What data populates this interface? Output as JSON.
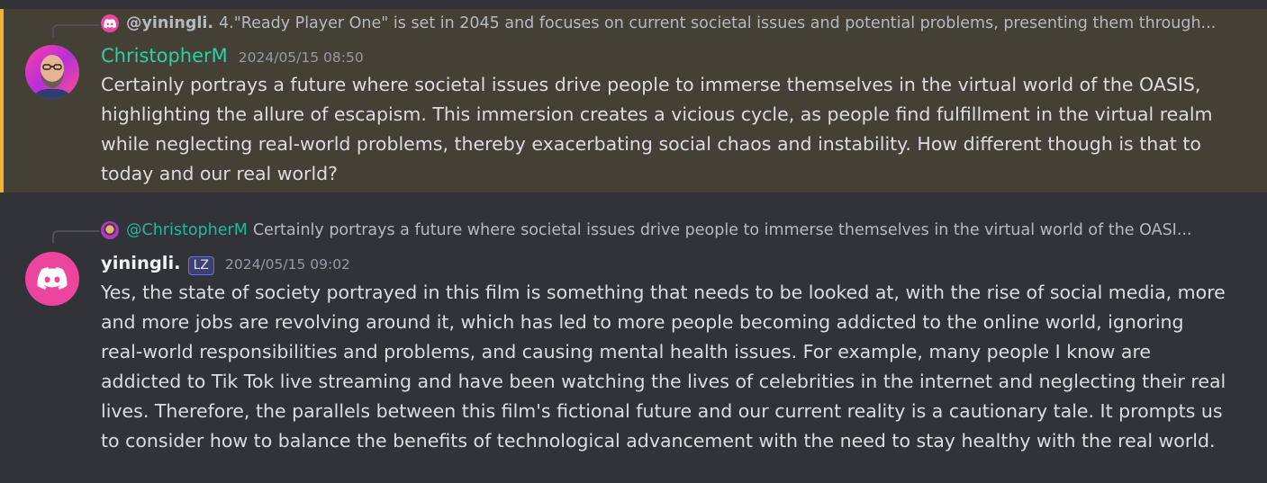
{
  "messages": [
    {
      "reply": {
        "user": "@yiningli.",
        "text": "4.\"Ready Player One\" is set in 2045 and focuses on current societal issues and potential problems, presenting them through..."
      },
      "author": "ChristopherM",
      "timestamp": "2024/05/15 08:50",
      "text": "Certainly portrays a future where societal issues drive people to immerse themselves in the virtual world of the OASIS, highlighting the allure of escapism. This immersion creates a vicious cycle, as people find fulfillment in the virtual realm while neglecting real-world problems, thereby exacerbating social chaos and instability. How different though is that to today and our real world?",
      "highlighted": true
    },
    {
      "reply": {
        "user": "@ChristopherM",
        "text": "Certainly portrays a future where societal issues drive people to immerse themselves in the virtual world of the OASI..."
      },
      "author": "yiningli.",
      "badge": "LZ",
      "timestamp": "2024/05/15 09:02",
      "text": "Yes, the state of society portrayed in this film is something that needs to be looked at, with the rise of social media, more and more jobs are revolving around it, which has led to more people becoming addicted to the online world, ignoring real-world responsibilities and problems, and causing mental health issues. For example, many people I know are addicted to Tik Tok live streaming and have been watching the lives of celebrities in the internet and neglecting their real lives. Therefore, the parallels between this film's fictional future and our current reality is a cautionary tale. It prompts us to consider how to balance the benefits of technological advancement with the need to stay healthy with the real world."
    }
  ],
  "colors": {
    "background": "#313338",
    "highlight_bg": "#444036",
    "highlight_border": "#f0b232",
    "author_teal": "#2ad0a6",
    "discord_pink": "#eb459e"
  },
  "icons": {
    "discord_avatar": "discord-logo-icon",
    "reply_spine": "reply-spine-icon"
  }
}
